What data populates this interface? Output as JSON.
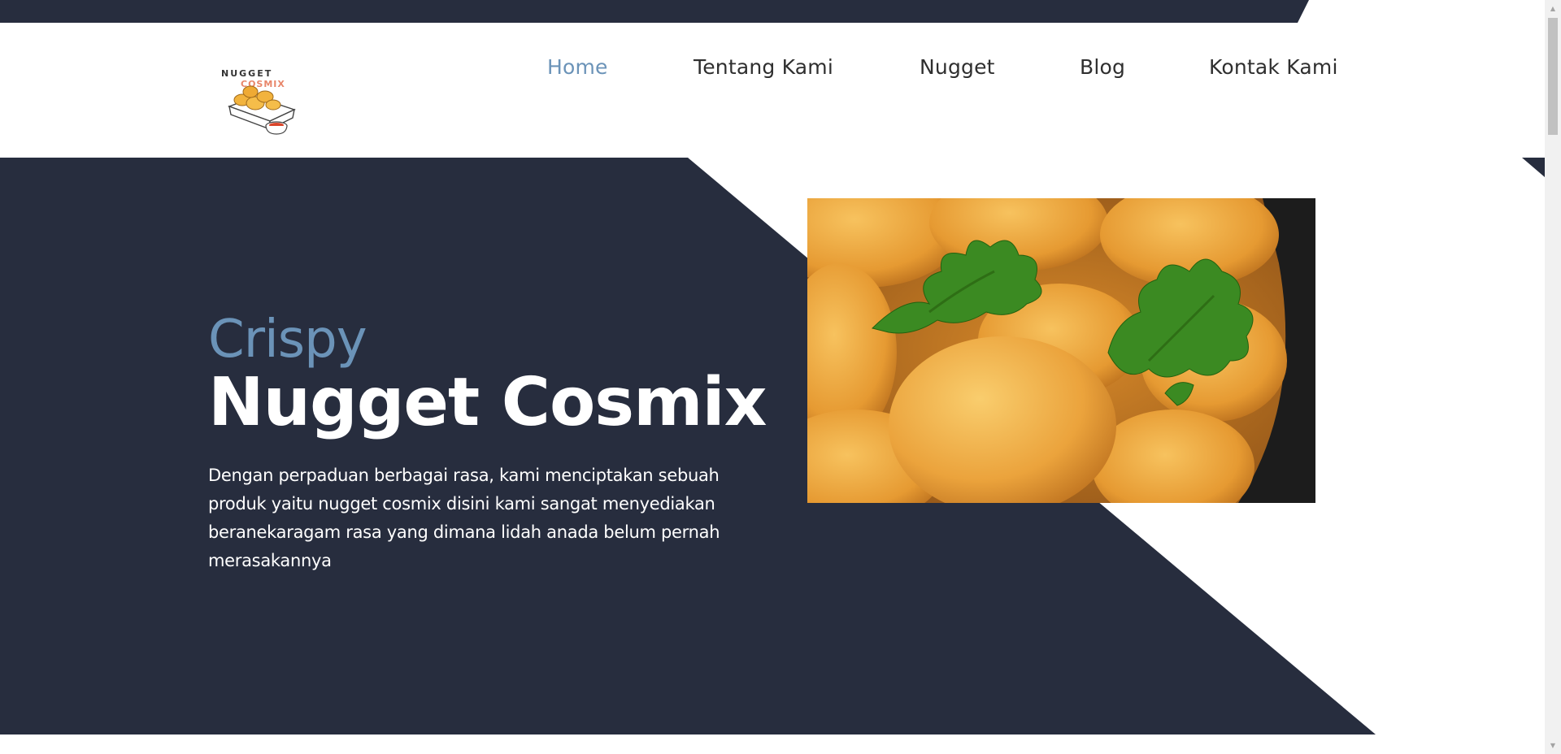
{
  "colors": {
    "navy": "#272d3e",
    "accent": "#6b93b8",
    "nav_text": "#2f2f2f",
    "white": "#ffffff"
  },
  "logo": {
    "text_top": "NUGGET",
    "text_bottom": "COSMIX",
    "icon": "nugget-box-logo"
  },
  "nav": {
    "items": [
      {
        "label": "Home",
        "active": true
      },
      {
        "label": "Tentang Kami",
        "active": false
      },
      {
        "label": "Nugget",
        "active": false
      },
      {
        "label": "Blog",
        "active": false
      },
      {
        "label": "Kontak Kami",
        "active": false
      }
    ]
  },
  "hero": {
    "subtitle": "Crispy",
    "title": "Nugget Cosmix",
    "description": "Dengan perpaduan berbagai rasa, kami menciptakan sebuah produk yaitu nugget cosmix disini kami sangat menyediakan beranekaragam rasa yang dimana lidah anada belum pernah merasakannya",
    "image": "fried-chicken-nuggets-with-parsley"
  },
  "scrollbar": {
    "up_icon": "scroll-up-arrow-icon",
    "down_icon": "scroll-down-arrow-icon"
  }
}
